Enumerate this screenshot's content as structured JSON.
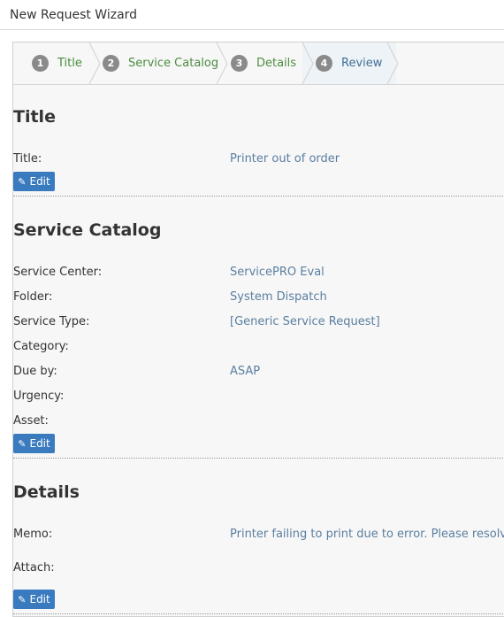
{
  "window": {
    "title": "New Request Wizard"
  },
  "steps": [
    {
      "number": "1",
      "label": "Title"
    },
    {
      "number": "2",
      "label": "Service Catalog"
    },
    {
      "number": "3",
      "label": "Details"
    },
    {
      "number": "4",
      "label": "Review"
    }
  ],
  "sections": {
    "title": {
      "heading": "Title",
      "fields": [
        {
          "label": "Title:",
          "value": "Printer out of order"
        }
      ],
      "edit_label": "Edit"
    },
    "service_catalog": {
      "heading": "Service Catalog",
      "fields": [
        {
          "label": "Service Center:",
          "value": "ServicePRO Eval"
        },
        {
          "label": "Folder:",
          "value": "System Dispatch"
        },
        {
          "label": "Service Type:",
          "value": "[Generic Service Request]"
        },
        {
          "label": "Category:",
          "value": ""
        },
        {
          "label": "Due by:",
          "value": "ASAP"
        },
        {
          "label": "Urgency:",
          "value": ""
        },
        {
          "label": "Asset:",
          "value": ""
        }
      ],
      "edit_label": "Edit"
    },
    "details": {
      "heading": "Details",
      "fields": [
        {
          "label": "Memo:",
          "value": "Printer failing to print due to error.  Please resolve"
        },
        {
          "label": "Attach:",
          "value": ""
        }
      ],
      "edit_label": "Edit"
    }
  },
  "colors": {
    "completed_step": "#4a8c3f",
    "active_step": "#3f6f95",
    "value_text": "#5a7ea0",
    "edit_button": "#3a7bbf"
  },
  "icons": {
    "edit": "pencil-icon"
  }
}
